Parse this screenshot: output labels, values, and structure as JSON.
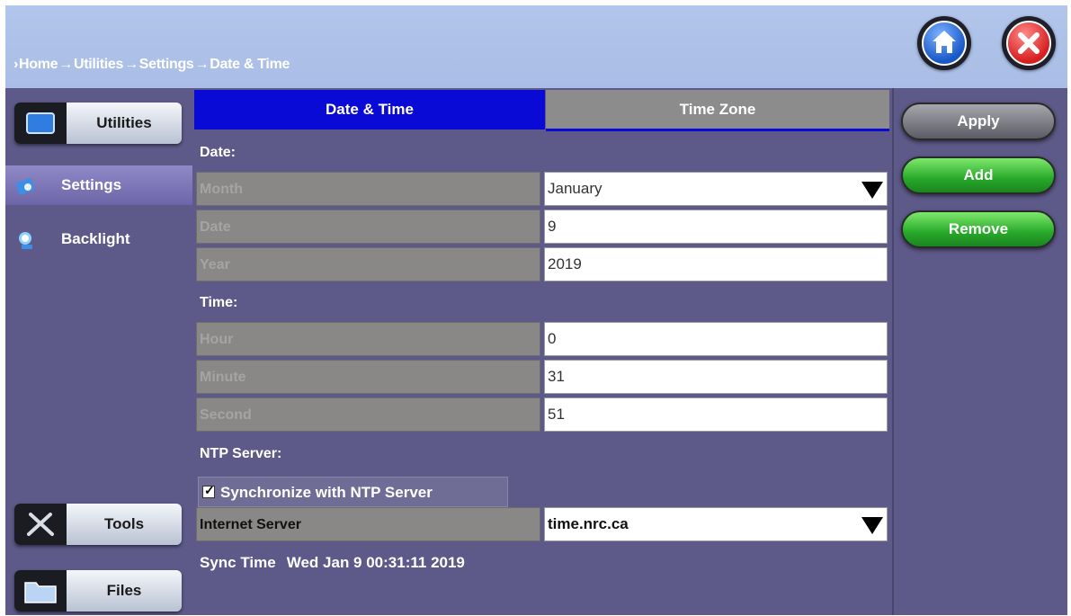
{
  "breadcrumb": [
    "Home",
    "Utilities",
    "Settings",
    "Date & Time"
  ],
  "header_buttons": {
    "home_icon": "home-icon",
    "close_icon": "close-icon"
  },
  "left_panel": {
    "top_button": {
      "label": "Utilities",
      "icon": "monitor-icon"
    },
    "items": [
      {
        "label": "Settings",
        "icon": "settings-icon",
        "active": true
      },
      {
        "label": "Backlight",
        "icon": "backlight-icon",
        "active": false
      }
    ],
    "bottom_buttons": [
      {
        "label": "Tools",
        "icon": "tools-icon"
      },
      {
        "label": "Files",
        "icon": "folder-icon"
      }
    ]
  },
  "tabs": [
    {
      "label": "Date & Time",
      "active": true
    },
    {
      "label": "Time Zone",
      "active": false
    }
  ],
  "date_section": {
    "title": "Date:",
    "month": {
      "label": "Month",
      "value": "January"
    },
    "date": {
      "label": "Date",
      "value": "9"
    },
    "year": {
      "label": "Year",
      "value": "2019"
    }
  },
  "time_section": {
    "title": "Time:",
    "hour": {
      "label": "Hour",
      "value": "0"
    },
    "minute": {
      "label": "Minute",
      "value": "31"
    },
    "second": {
      "label": "Second",
      "value": "51"
    }
  },
  "ntp_section": {
    "title": "NTP Server:",
    "sync_checkbox": {
      "label": "Synchronize with NTP Server",
      "checked": true
    },
    "internet_server": {
      "label": "Internet Server",
      "value": "time.nrc.ca"
    },
    "sync_time": {
      "label": "Sync Time",
      "value": "Wed Jan 9 00:31:11 2019"
    }
  },
  "actions": {
    "apply": "Apply",
    "add": "Add",
    "remove": "Remove"
  },
  "colors": {
    "panel_bg": "#5d5988",
    "active_tab": "#0a0ad6",
    "header_bg": "#b2c5ea",
    "green_button": "#27a82a"
  }
}
